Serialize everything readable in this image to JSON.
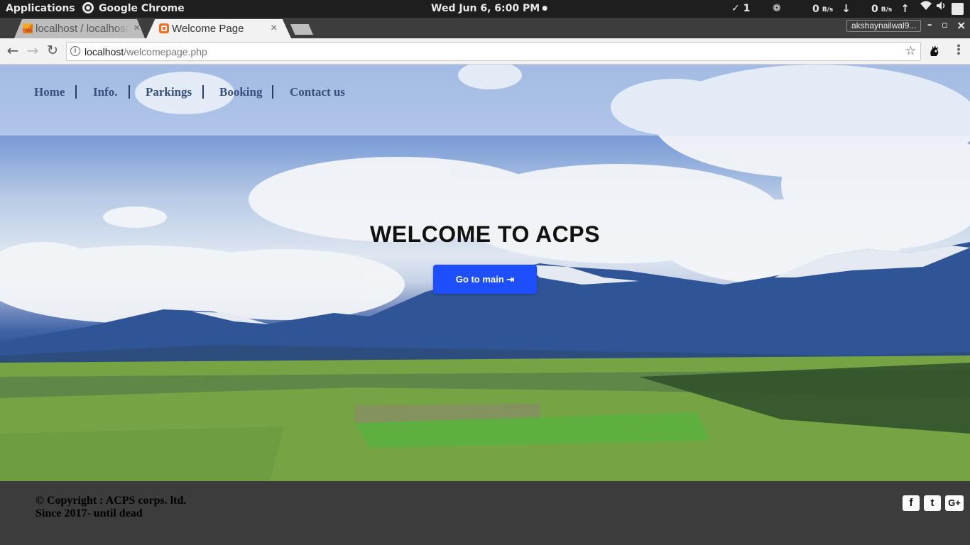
{
  "topbar": {
    "applications": "Applications",
    "active_app": "Google Chrome",
    "clock": "Wed Jun  6,  6:00 PM",
    "clock_dot": "●",
    "tasks_count": "1",
    "net_down_value": "0",
    "net_down_unit": "B/s",
    "net_up_value": "0",
    "net_up_unit": "B/s"
  },
  "browser": {
    "tabs": [
      {
        "title": "localhost / localhost",
        "favicon": "phpmyadmin-icon",
        "active": false
      },
      {
        "title": "Welcome Page",
        "favicon": "xampp-icon",
        "active": true
      }
    ],
    "profile_name": "akshaynailwal9...",
    "url_host": "localhost",
    "url_path": "/welcomepage.php"
  },
  "site": {
    "nav": [
      "Home",
      "Info.",
      "Parkings",
      "Booking",
      "Contact us"
    ],
    "hero_title": "WELCOME TO ACPS",
    "cta_label": "Go to main ⇥",
    "footer_line1": "© Copyright : ACPS corps. ltd.",
    "footer_line2": "Since 2017- until dead",
    "social": [
      "f",
      "t",
      "G+"
    ]
  },
  "colors": {
    "cta_bg": "#1e4fff",
    "footer_bg": "#3c3c3c",
    "nav_text": "#38507c"
  }
}
